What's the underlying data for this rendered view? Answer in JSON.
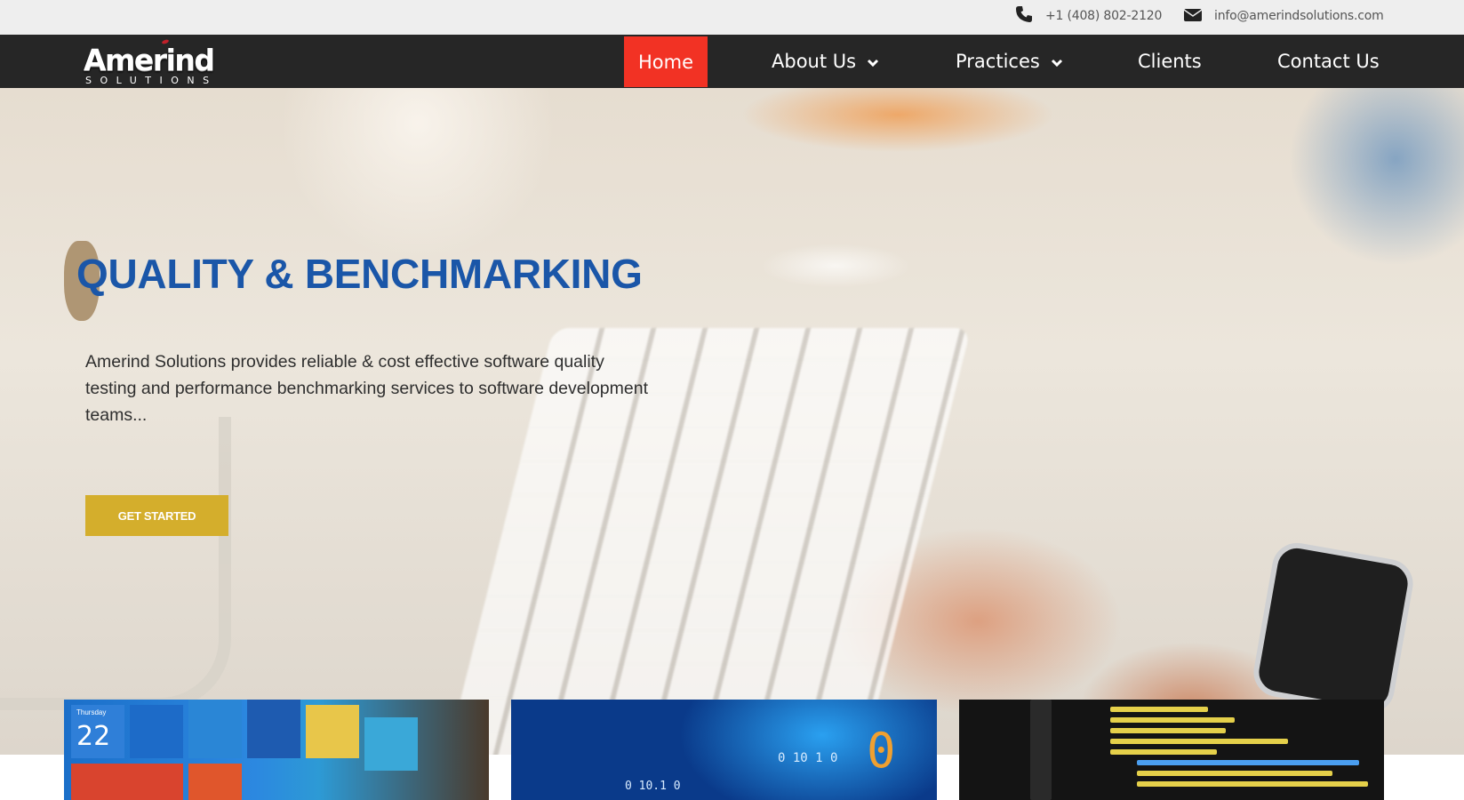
{
  "topbar": {
    "phone": "+1 (408) 802-2120",
    "email": "info@amerindsolutions.com",
    "phone_icon": "phone-icon",
    "email_icon": "envelope-icon"
  },
  "brand": {
    "name": "Amerind",
    "tagline": "SOLUTIONS"
  },
  "nav": {
    "items": [
      {
        "label": "Home",
        "active": true
      },
      {
        "label": "About Us",
        "dropdown": true
      },
      {
        "label": "Practices",
        "dropdown": true
      },
      {
        "label": "Clients"
      },
      {
        "label": "Contact Us"
      }
    ]
  },
  "hero": {
    "title": "QUALITY & BENCHMARKING",
    "text": "Amerind Solutions provides reliable & cost effective software quality testing and performance benchmarking services to software development teams...",
    "button_label": "GET STARTED"
  },
  "cards": {
    "tile_date_day": "Thursday",
    "tile_date_num": "22",
    "binary_1": "0 10 1 0",
    "binary_2": "0 10.1 0",
    "binary_big": "0"
  },
  "colors": {
    "nav_bg": "#262626",
    "active": "#f23224",
    "title": "#1a56a8",
    "button": "#d4ae2c"
  }
}
